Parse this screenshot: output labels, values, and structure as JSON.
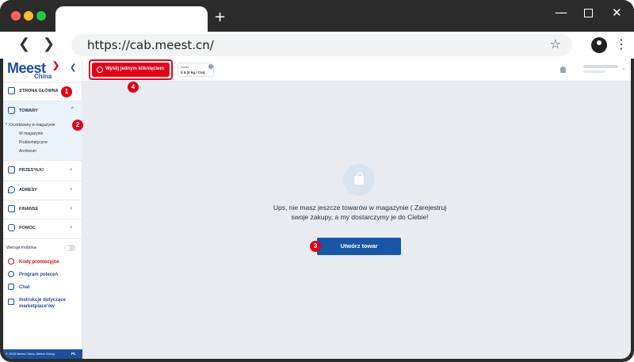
{
  "browser": {
    "url": "https://cab.meest.cn/",
    "new_tab_glyph": "+",
    "back_glyph": "❮",
    "forward_glyph": "❯",
    "star_glyph": "☆",
    "kebab_glyph": "⋮",
    "minimize_glyph": "—",
    "close_glyph": "✕"
  },
  "brand": {
    "logo_text": "Meest",
    "logo_sub": "China",
    "logo_mark": "❯",
    "collapse_glyph": "❮",
    "brand_color": "#1d4f9c",
    "accent_color": "#e2001a"
  },
  "sidebar": {
    "items": [
      {
        "label": "STRONA GŁÓWNA",
        "icon": "grid-icon"
      },
      {
        "label": "TOWARY",
        "icon": "bag-icon",
        "chevron": "⌃"
      },
      {
        "label": "PRZESYŁKI",
        "icon": "package-icon",
        "chevron": "›"
      },
      {
        "label": "ADRESY",
        "icon": "location-icon",
        "chevron": "›"
      },
      {
        "label": "FINANSE",
        "icon": "wallet-icon",
        "chevron": "›"
      },
      {
        "label": "POMOC",
        "icon": "chat-icon",
        "chevron": "›"
      }
    ],
    "towary_sub": [
      "Oczekiwany w magazynie",
      "W magazynie",
      "Problematyczne",
      "Archiwum"
    ],
    "mobile_toggle_label": "Wersja mobilna",
    "links": [
      {
        "label": "Kody promocyjne",
        "icon": "percent-icon"
      },
      {
        "label": "Program poleceń",
        "icon": "user-icon"
      },
      {
        "label": "Chat",
        "icon": "chat-bubble-icon"
      },
      {
        "label": "Instrukcje dotyczące marketplace'ów",
        "icon": "book-icon"
      }
    ],
    "footer_text": "© 2025 Meest China, Meest Group",
    "footer_lang": "PL"
  },
  "topbar": {
    "send_button_label": "Wyślij jednym kliknięciem",
    "saldo_label": "Saldo",
    "saldo_value": "0 $ (0 kg / Cm)",
    "saldo_help": "?",
    "user_chevron": "⌄"
  },
  "main": {
    "empty_message": "Ups, nie masz jeszcze towarów w magazynie ( Zarejestruj swoje zakupy, a my dostarczymy je do Ciebie!",
    "create_button_label": "Utwórz towar"
  },
  "markers": [
    "1",
    "2",
    "3",
    "4"
  ]
}
